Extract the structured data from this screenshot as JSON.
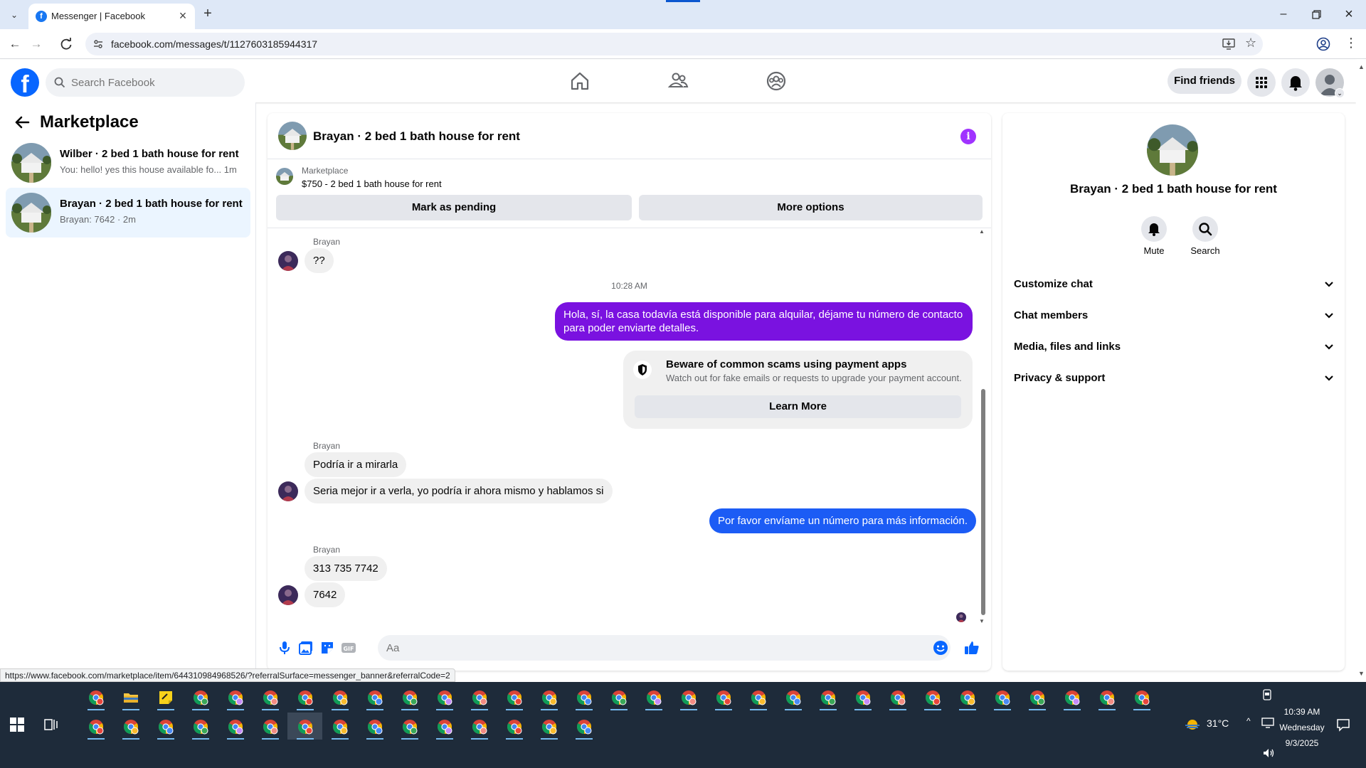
{
  "browser": {
    "tab_title": "Messenger | Facebook",
    "tab_favicon_letter": "f",
    "url": "facebook.com/messages/t/1127603185944317",
    "status_url": "https://www.facebook.com/marketplace/item/644310984968526/?referralSurface=messenger_banner&referralCode=2"
  },
  "fb_header": {
    "logo_letter": "f",
    "search_placeholder": "Search Facebook",
    "find_friends_label": "Find friends",
    "brand_color": "#0866ff"
  },
  "left_panel": {
    "title": "Marketplace",
    "conversations": [
      {
        "title": "Wilber · 2 bed 1 bath house for rent",
        "preview": "You: hello! yes this house available fo...",
        "time": "1m",
        "active": false
      },
      {
        "title": "Brayan · 2 bed 1 bath house for rent",
        "preview": "Brayan: 7642 · 2m",
        "time": "",
        "active": true
      }
    ]
  },
  "chat": {
    "header_title": "Brayan · 2 bed 1 bath house for rent",
    "info_icon_label": "i",
    "marketplace_label": "Marketplace",
    "item_summary": "$750 - 2 bed 1 bath house for rent",
    "mark_pending_label": "Mark as pending",
    "more_options_label": "More options",
    "messages": {
      "sender_1": "Brayan",
      "msg_1": "??",
      "timestamp": "10:28 AM",
      "out_1": "Hola, sí, la casa todavía está disponible para alquilar, déjame tu número de contacto para poder enviarte detalles.",
      "scam_title": "Beware of common scams using payment apps",
      "scam_desc": "Watch out for fake emails or requests to upgrade your payment account.",
      "learn_more": "Learn More",
      "sender_2": "Brayan",
      "msg_2": "Podría ir a mirarla",
      "msg_3": "Seria mejor ir a verla, yo podría ir ahora mismo y hablamos si",
      "out_2": "Por favor envíame un número para más información.",
      "sender_3": "Brayan",
      "msg_4": "313 735 7742",
      "msg_5": "7642"
    },
    "composer_placeholder": "Aa",
    "outgoing_color": "#7a12e0",
    "outgoing_blue": "#1c5cf5"
  },
  "right_panel": {
    "title": "Brayan · 2 bed 1 bath house for rent",
    "mute_label": "Mute",
    "search_label": "Search",
    "rows": [
      "Customize chat",
      "Chat members",
      "Media, files and links",
      "Privacy & support"
    ]
  },
  "taskbar": {
    "temperature": "31°C",
    "time": "10:39 AM",
    "day": "Wednesday",
    "date": "9/3/2025"
  }
}
